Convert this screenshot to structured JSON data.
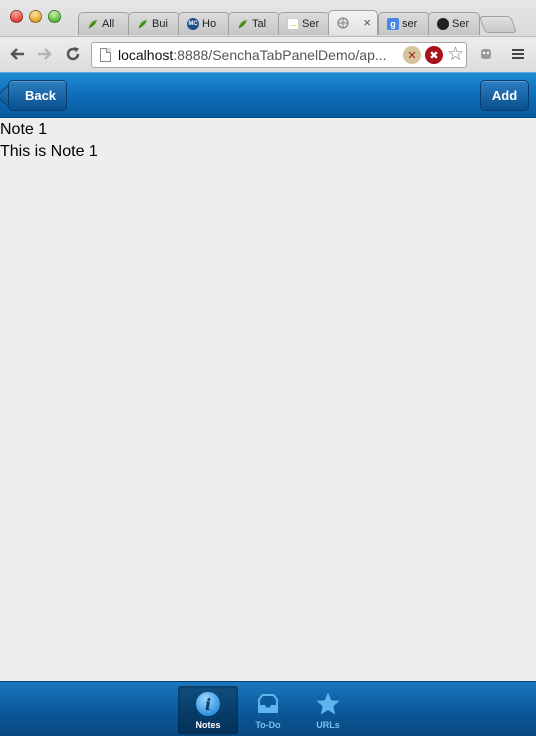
{
  "browser": {
    "tabs": [
      {
        "label": "All",
        "icon": "sencha-leaf-icon"
      },
      {
        "label": "Bui",
        "icon": "sencha-leaf-icon"
      },
      {
        "label": "Ho",
        "icon": "mc-icon"
      },
      {
        "label": "Tal",
        "icon": "sencha-leaf-icon"
      },
      {
        "label": "Ser",
        "icon": "arrows-icon"
      },
      {
        "label": "",
        "icon": "globe-icon"
      },
      {
        "label": "ser",
        "icon": "google-icon"
      },
      {
        "label": "Ser",
        "icon": "github-icon"
      }
    ],
    "url": {
      "host": "localhost",
      "rest": ":8888/SenchaTabPanelDemo/ap..."
    }
  },
  "titlebar": {
    "back_label": "Back",
    "add_label": "Add"
  },
  "note": {
    "title": "Note 1",
    "body": "This is Note 1"
  },
  "tabbar": {
    "items": [
      {
        "label": "Notes",
        "icon": "info-icon",
        "active": true
      },
      {
        "label": "To-Do",
        "icon": "inbox-icon",
        "active": false
      },
      {
        "label": "URLs",
        "icon": "star-icon",
        "active": false
      }
    ]
  },
  "colors": {
    "titlebar": "#0d6db8",
    "tab_inactive": "#7cc1f1",
    "tab_active": "#ffffff"
  }
}
